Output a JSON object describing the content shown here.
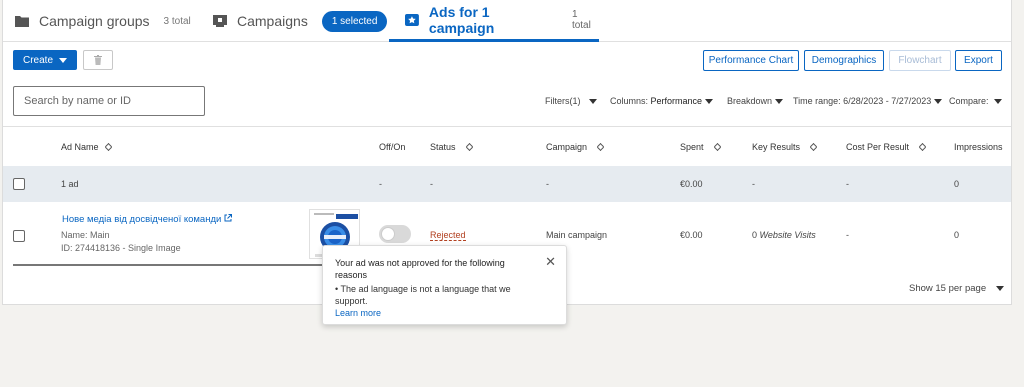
{
  "tabs": [
    {
      "label": "Campaign groups",
      "count": "3 total"
    },
    {
      "label": "Campaigns",
      "badge": "1 selected"
    },
    {
      "label": "Ads for 1 campaign",
      "count": "1 total"
    }
  ],
  "toolbar": {
    "create": "Create",
    "performance_chart": "Performance Chart",
    "demographics": "Demographics",
    "flowchart": "Flowchart",
    "export": "Export"
  },
  "search": {
    "placeholder": "Search by name or ID"
  },
  "filters": {
    "filters": "Filters(1)",
    "columns_label": "Columns:",
    "columns_value": "Performance",
    "breakdown": "Breakdown",
    "time_range": "Time range: 6/28/2023 - 7/27/2023",
    "compare": "Compare:"
  },
  "columns": [
    "Ad Name",
    "Off/On",
    "Status",
    "Campaign",
    "Spent",
    "Key Results",
    "Cost Per Result",
    "Impressions"
  ],
  "total_row": {
    "name": "1 ad",
    "offon": "-",
    "status": "-",
    "campaign": "-",
    "spent": "€0.00",
    "key_results": "-",
    "cost": "-",
    "impressions": "0"
  },
  "ad_row": {
    "name": "Нове медіа від досвідченої команди",
    "subname": "Name: Main",
    "id": "ID: 274418136 - Single Image",
    "status": "Rejected",
    "campaign": "Main campaign",
    "spent": "€0.00",
    "key_results_num": "0",
    "key_results_unit": "Website Visits",
    "cost": "-",
    "impressions": "0"
  },
  "popover": {
    "title": "Your ad was not approved for the following reasons",
    "reason": "• The ad language is not a language that we support.",
    "learn_more": "Learn more"
  },
  "footer": {
    "per_page": "Show 15 per page"
  },
  "colors": {
    "accent": "#0a66c2",
    "rejected": "#b24020"
  }
}
